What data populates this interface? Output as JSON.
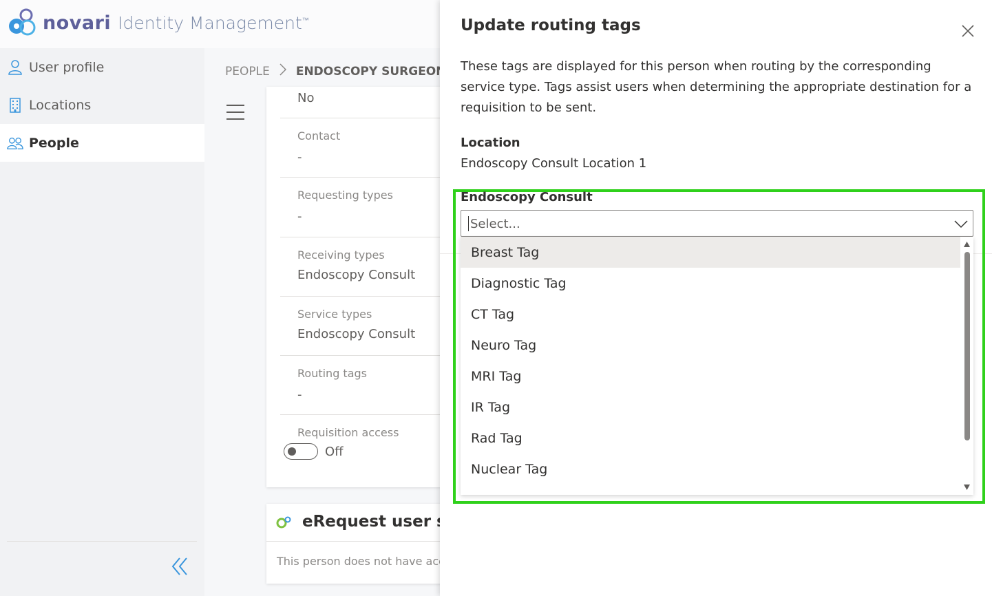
{
  "header": {
    "brand": "novari",
    "product": "Identity Management",
    "trademark": "™"
  },
  "sidebar": {
    "items": [
      {
        "label": "User profile",
        "icon": "person-icon"
      },
      {
        "label": "Locations",
        "icon": "building-icon"
      },
      {
        "label": "People",
        "icon": "people-icon"
      }
    ],
    "active": "People",
    "collapse_icon": "double-chevron-left-icon"
  },
  "breadcrumb": {
    "root": "PEOPLE",
    "current": "ENDOSCOPY SURGEON #"
  },
  "profile_card": {
    "top_value": "No",
    "fields": [
      {
        "label": "Contact",
        "value": "-"
      },
      {
        "label": "Requesting types",
        "value": "-"
      },
      {
        "label": "Receiving types",
        "value": "Endoscopy Consult"
      },
      {
        "label": "Service types",
        "value": "Endoscopy Consult"
      },
      {
        "label": "Routing tags",
        "value": "-"
      }
    ],
    "requisition_access": {
      "label": "Requisition access",
      "state": "Off"
    }
  },
  "erequest_card": {
    "title": "eRequest user set",
    "text": "This person does not have acce"
  },
  "panel": {
    "title": "Update routing tags",
    "description": "These tags are displayed for this person when routing by the corresponding service type. Tags assist users when determining the appropriate destination for a requisition to be sent.",
    "location_label": "Location",
    "location_value": "Endoscopy Consult Location 1",
    "select": {
      "label": "Endoscopy Consult",
      "placeholder": "Select...",
      "options": [
        "Breast Tag",
        "Diagnostic Tag",
        "CT Tag",
        "Neuro Tag",
        "MRI Tag",
        "IR Tag",
        "Rad Tag",
        "Nuclear Tag"
      ],
      "hovered": "Breast Tag"
    }
  },
  "colors": {
    "highlight": "#2fd11b",
    "brand": "#5d5f9a",
    "accent": "#3a96dd"
  }
}
